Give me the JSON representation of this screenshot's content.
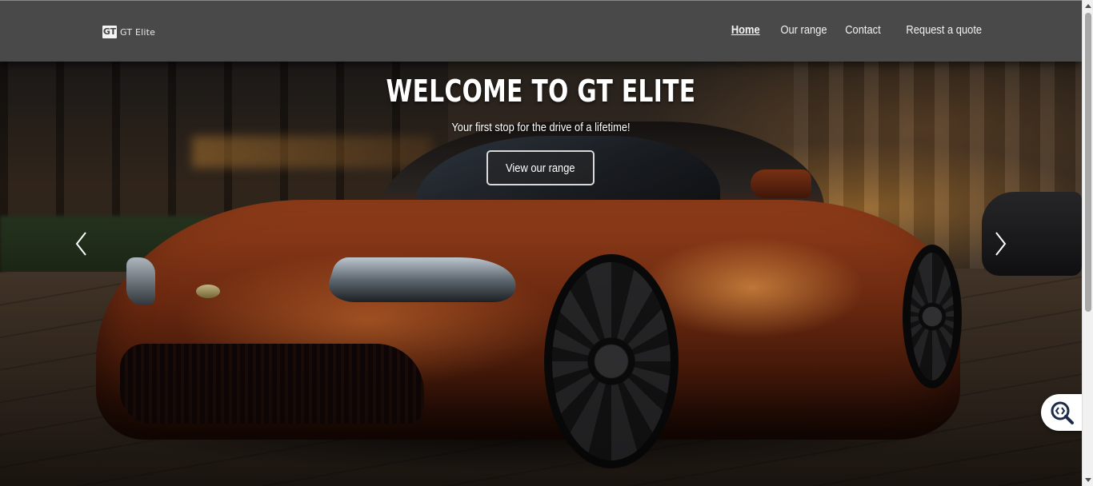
{
  "brand": {
    "logo_text": "GT",
    "name": "GT Elite"
  },
  "nav": {
    "items": [
      {
        "label": "Home",
        "active": true
      },
      {
        "label": "Our range",
        "active": false
      },
      {
        "label": "Contact",
        "active": false
      },
      {
        "label": "Request a quote",
        "active": false
      }
    ]
  },
  "hero": {
    "title": "WELCOME TO GT ELITE",
    "subtitle": "Your first stop for the drive of a lifetime!",
    "cta_label": "View our range"
  },
  "carousel": {
    "prev_icon": "chevron-left-icon",
    "next_icon": "chevron-right-icon"
  },
  "fab": {
    "icon": "accessibility-zoom-icon"
  },
  "colors": {
    "navbar_bg": "#4a4a4a",
    "text": "#ffffff",
    "car_accent": "#a6461d"
  }
}
